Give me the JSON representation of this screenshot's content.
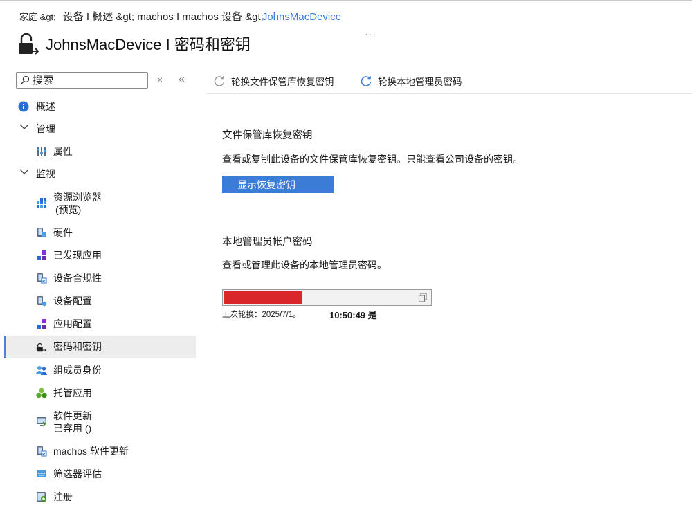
{
  "breadcrumb": {
    "home": "家庭 &gt;",
    "path": "设备 I 概述 &gt; machos I machos 设备 &gt;",
    "device": "JohnsMacDevice"
  },
  "title": "JohnsMacDevice I 密码和密钥",
  "more": "···",
  "search": {
    "placeholder": "搜索",
    "clear": "×",
    "collapse": "«"
  },
  "nav": {
    "overview": "概述",
    "manage": "管理",
    "properties": "属性",
    "monitor": "监视",
    "resource_explorer_1": "资源浏览器",
    "resource_explorer_2": "(预览)",
    "hardware": "硬件",
    "discovered_apps": "已发现应用",
    "device_compliance": "设备合规性",
    "device_config": "设备配置",
    "app_config": "应用配置",
    "passwords_keys": "密码和密钥",
    "group_membership": "组成员身份",
    "managed_apps": "托管应用",
    "software_updates_1": "软件更新",
    "software_updates_2": "已弃用 ()",
    "macos_updates": "machos 软件更新",
    "filter_eval": "筛选器评估",
    "enrollment": "注册"
  },
  "commands": {
    "rotate_filevault": "轮换文件保管库恢复密钥",
    "rotate_local_admin": "轮换本地管理员密码"
  },
  "filevault": {
    "title": "文件保管库恢复密钥",
    "desc": "查看或复制此设备的文件保管库恢复密钥。只能查看公司设备的密钥。",
    "button": "显示恢复密钥"
  },
  "local_admin": {
    "title": "本地管理员帐户密码",
    "desc": "查看或管理此设备的本地管理员密码。",
    "last_rotated": "上次轮换：2025/7/1。",
    "last_rotated_time": "10:50:49 是"
  },
  "colors": {
    "accent": "#3b7cd6",
    "redaction": "#d9262b",
    "active_bg": "#ededed"
  }
}
